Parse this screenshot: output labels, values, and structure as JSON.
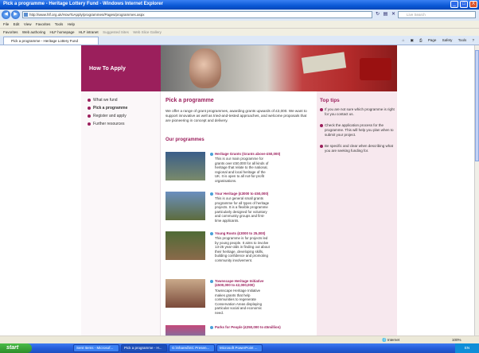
{
  "window": {
    "title": "Pick a programme - Heritage Lottery Fund - Windows Internet Explorer",
    "buttons": [
      "_",
      "□",
      "X"
    ]
  },
  "address": {
    "url": "http://www.hlf.org.uk/HowToApply/programmes/Pages/programmes.aspx",
    "search_placeholder": "Live Search"
  },
  "menu": [
    "File",
    "Edit",
    "View",
    "Favorites",
    "Tools",
    "Help"
  ],
  "favorites": {
    "label": "Favorites",
    "items": [
      "Web authoring",
      "HLF homepage",
      "HLF intranet",
      "Suggested Sites",
      "Web Slice Gallery"
    ]
  },
  "tab": {
    "label": "Pick a programme - Heritage Lottery Fund"
  },
  "toolbar": {
    "items": [
      "Page",
      "Safety",
      "Tools"
    ]
  },
  "page": {
    "section_title": "How To Apply",
    "nav": [
      {
        "label": "What we fund",
        "active": false
      },
      {
        "label": "Pick a programme",
        "active": true
      },
      {
        "label": "Register and apply",
        "active": false
      },
      {
        "label": "Further resources",
        "active": false
      }
    ],
    "heading": "Pick a programme",
    "intro": "We offer a range of grant programmes, awarding grants upwards of £3,000. We want to support innovative as well as tried-and-tested approaches, and welcome proposals that are pioneering in concept and delivery.",
    "our_programmes": "Our programmes",
    "programmes": [
      {
        "title": "Heritage Grants (Grants above £50,000)",
        "desc": "This is our main programme for grants over £50,000 for all kinds of heritage that relate to the national, regional and local heritage of the UK. It is open to all not-for-profit organisations."
      },
      {
        "title": "Your Heritage (£3000 to £50,000)",
        "desc": "This is our general small grants programme for all types of heritage projects. It is a flexible programme particularly designed for voluntary and community groups and first-time applicants."
      },
      {
        "title": "Young Roots (£3000 to 25,000)",
        "desc": "This programme is for projects led by young people. It aims to involve 13-25 year-olds in finding out about their heritage, developing skills, building confidence and promoting community involvement."
      },
      {
        "title": "Townscape Heritage Initiative (£500,000 to £2,000,000)",
        "desc": "Townscape Heritage Initiative makes grants that help communities to regenerate Conservation Areas displaying particular social and economic need."
      },
      {
        "title": "Parks for People (£250,000 to £5million)",
        "desc": ""
      }
    ],
    "tips_title": "Top tips",
    "tips": [
      "If you are not sure which programme is right for you contact us.",
      "Check the application process for the programme. This will help you plan when to submit your project.",
      "Be specific and clear when describing what you are seeking funding for."
    ]
  },
  "status": {
    "zone": "Internet",
    "zoom": "100%"
  },
  "taskbar": {
    "start": "start",
    "buttons": [
      "Sent Items - Microsof...",
      "Pick a programme - H...",
      "G:\\Shared\\SC Presen...",
      "Microsoft PowerPoint ..."
    ],
    "clock": "EN"
  }
}
